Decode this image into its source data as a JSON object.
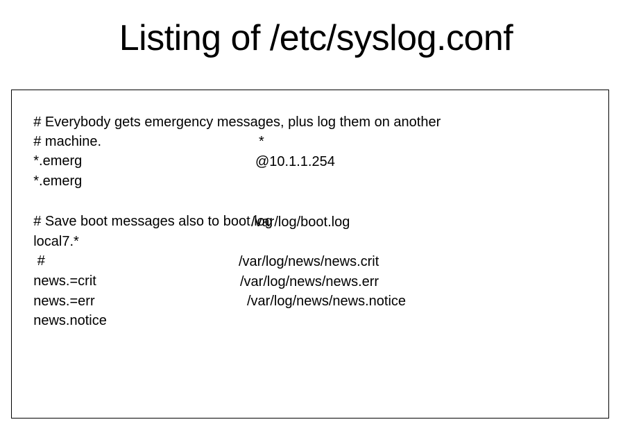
{
  "slide": {
    "title": "Listing of /etc/syslog.conf"
  },
  "listing": {
    "lines": [
      {
        "selector": "# Everybody gets emergency messages, plus log them on another",
        "action": ""
      },
      {
        "selector": "# machine.",
        "action": ""
      },
      {
        "selector": "*.emerg",
        "action": "*"
      },
      {
        "selector": "*.emerg",
        "action": "@10.1.1.254"
      },
      {
        "selector": "",
        "action": ""
      },
      {
        "selector": "# Save boot messages also to boot.log",
        "action": ""
      },
      {
        "selector": "local7.*",
        "action": "/var/log/boot.log"
      },
      {
        "selector": " #",
        "action": ""
      },
      {
        "selector": "news.=crit",
        "action": "/var/log/news/news.crit"
      },
      {
        "selector": "news.=err",
        "action": "/var/log/news/news.err"
      },
      {
        "selector": "news.notice",
        "action": "/var/log/news/news.notice"
      }
    ]
  }
}
